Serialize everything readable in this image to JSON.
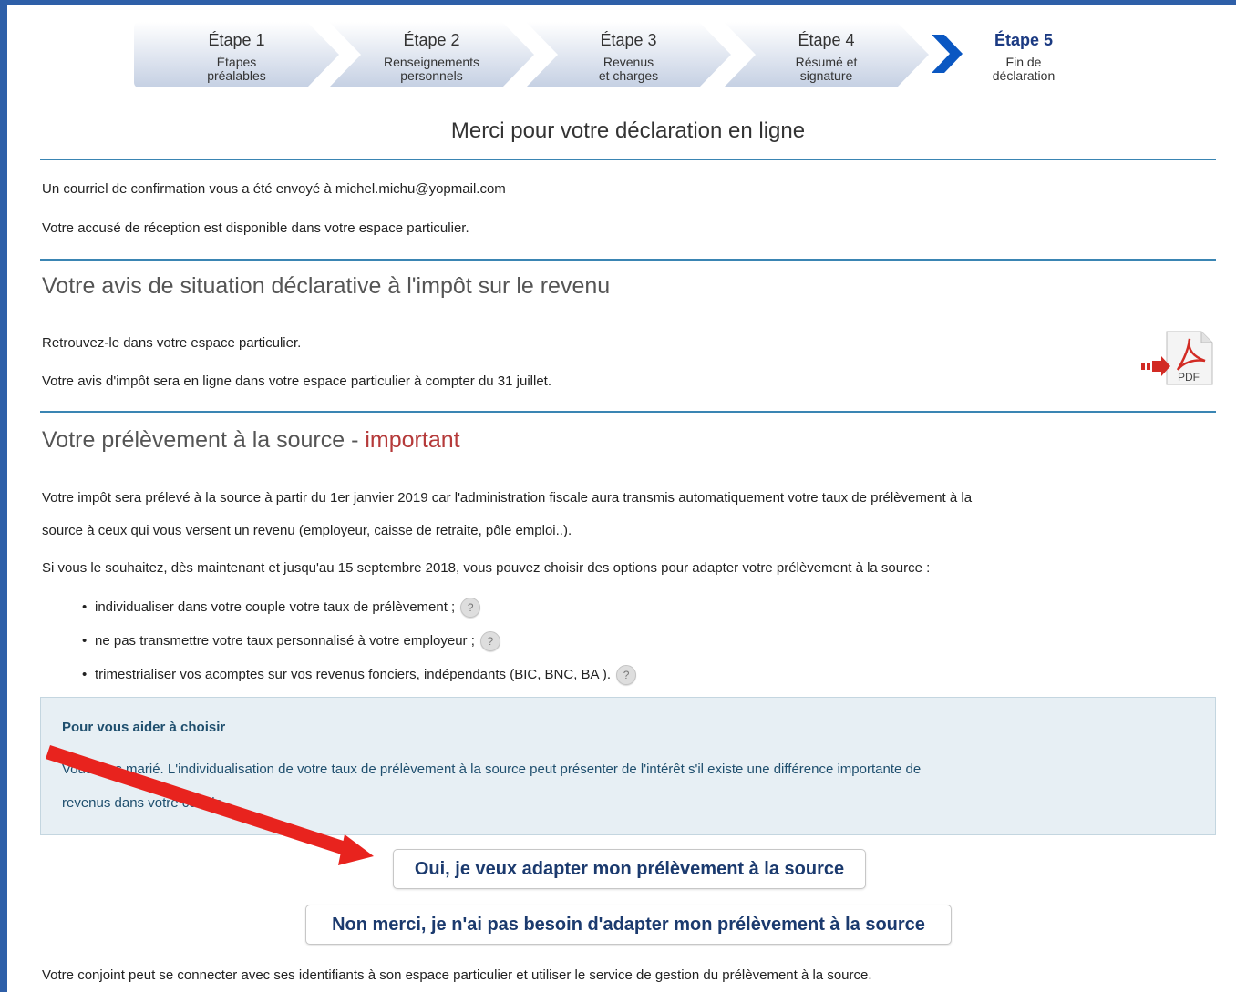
{
  "steps": [
    {
      "label": "Étape 1",
      "sub1": "Étapes",
      "sub2": "préalables"
    },
    {
      "label": "Étape 2",
      "sub1": "Renseignements",
      "sub2": "personnels"
    },
    {
      "label": "Étape 3",
      "sub1": "Revenus",
      "sub2": "et charges"
    },
    {
      "label": "Étape 4",
      "sub1": "Résumé et",
      "sub2": "signature"
    },
    {
      "label": "Étape 5",
      "sub1": "Fin de",
      "sub2": "déclaration"
    }
  ],
  "page_title": "Merci pour votre déclaration en ligne",
  "confirmation": {
    "email_text": "Un courriel de confirmation vous a été envoyé à michel.michu@yopmail.com",
    "receipt_text": "Votre accusé de réception est disponible dans votre espace particulier."
  },
  "avis": {
    "heading": "Votre avis de situation déclarative à l'impôt sur le revenu",
    "line1": "Retrouvez-le dans votre espace particulier.",
    "line2": "Votre avis d'impôt sera en ligne dans votre espace particulier à compter du 31 juillet.",
    "pdf_label": "PDF"
  },
  "prelevement": {
    "heading_main": "Votre prélèvement à la source - ",
    "heading_important": "important",
    "para1_line1": "Votre impôt sera prélevé à la source à partir du 1er janvier 2019 car l'administration fiscale aura transmis automatiquement votre taux de prélèvement à la",
    "para1_line2": "source à ceux qui vous versent un revenu (employeur, caisse de retraite, pôle emploi..).",
    "para2": "Si vous le souhaitez, dès maintenant et jusqu'au 15 septembre 2018, vous pouvez choisir des options pour adapter votre prélèvement à la source :",
    "options": [
      "individualiser dans votre couple votre taux de prélèvement ;",
      "ne pas transmettre votre taux personnalisé à votre employeur ;",
      "trimestrialiser vos acomptes sur vos revenus fonciers, indépendants (BIC, BNC, BA )."
    ],
    "help_glyph": "?"
  },
  "help_box": {
    "title": "Pour vous aider à choisir",
    "line1": "Vous êtes marié. L'individualisation de votre taux de prélèvement à la source peut présenter de l'intérêt s'il existe une différence importante de",
    "line2": "revenus dans votre couple."
  },
  "buttons": {
    "yes": "Oui, je veux adapter mon prélèvement à la source",
    "no": "Non merci, je n'ai pas besoin d'adapter mon prélèvement à la source"
  },
  "footer_text": "Votre conjoint peut se connecter avec ses identifiants à son espace particulier et utiliser le service de gestion du prélèvement à la source.",
  "colors": {
    "frame": "#2e5fa8",
    "rule": "#3a85b3",
    "important": "#b53a3a",
    "help_box_bg": "#e7eff4",
    "annotation_arrow": "#e8231e"
  }
}
